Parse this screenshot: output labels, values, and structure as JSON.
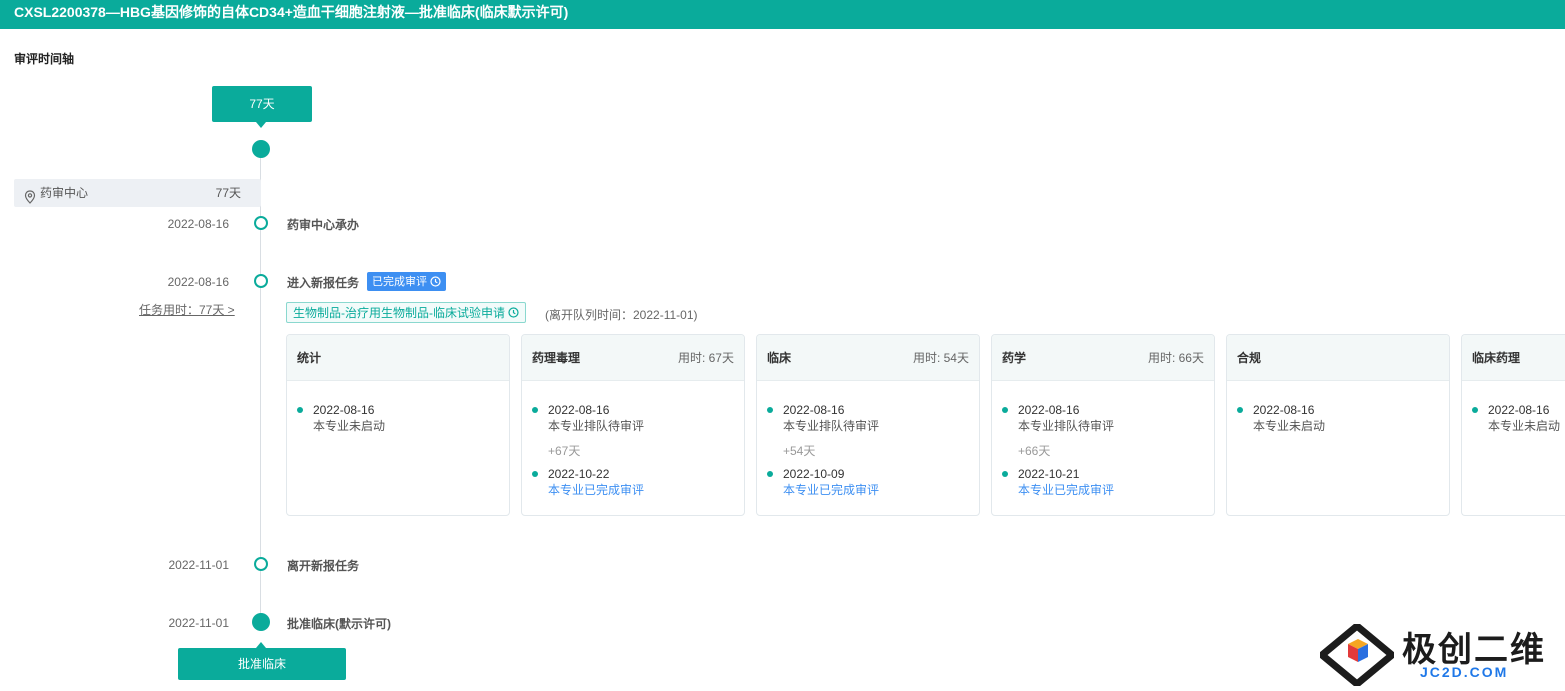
{
  "header": {
    "title": "CXSL2200378—HBG基因修饰的自体CD34+造血干细胞注射液—批准临床(临床默示许可)"
  },
  "timeline": {
    "section_title": "审评时间轴",
    "total_badge": "77天",
    "center": {
      "name": "药审中心",
      "days": "77天"
    },
    "events": [
      {
        "date": "2022-08-16",
        "label": "药审中心承办"
      },
      {
        "date": "2022-08-16",
        "label": "进入新报任务",
        "status": "已完成审评",
        "task_link": "任务用时：77天 >"
      },
      {
        "date": "2022-11-01",
        "label": "离开新报任务"
      },
      {
        "date": "2022-11-01",
        "label": "批准临床(默示许可)"
      }
    ],
    "task_type_tag": "生物制品-治疗用生物制品-临床试验申请",
    "leave_queue_time": "(离开队列时间：2022-11-01)",
    "final_badge": "批准临床"
  },
  "cards": [
    {
      "name": "统计",
      "used": "",
      "entries": [
        {
          "date": "2022-08-16",
          "status": "本专业未启动",
          "done": false
        }
      ],
      "gap": ""
    },
    {
      "name": "药理毒理",
      "used": "用时: 67天",
      "entries": [
        {
          "date": "2022-08-16",
          "status": "本专业排队待审评",
          "done": false
        },
        {
          "date": "2022-10-22",
          "status": "本专业已完成审评",
          "done": true
        }
      ],
      "gap": "+67天"
    },
    {
      "name": "临床",
      "used": "用时: 54天",
      "entries": [
        {
          "date": "2022-08-16",
          "status": "本专业排队待审评",
          "done": false
        },
        {
          "date": "2022-10-09",
          "status": "本专业已完成审评",
          "done": true
        }
      ],
      "gap": "+54天"
    },
    {
      "name": "药学",
      "used": "用时: 66天",
      "entries": [
        {
          "date": "2022-08-16",
          "status": "本专业排队待审评",
          "done": false
        },
        {
          "date": "2022-10-21",
          "status": "本专业已完成审评",
          "done": true
        }
      ],
      "gap": "+66天"
    },
    {
      "name": "合规",
      "used": "",
      "entries": [
        {
          "date": "2022-08-16",
          "status": "本专业未启动",
          "done": false
        }
      ],
      "gap": ""
    },
    {
      "name": "临床药理",
      "used": "",
      "entries": [
        {
          "date": "2022-08-16",
          "status": "本专业未启动",
          "done": false
        }
      ],
      "gap": ""
    }
  ],
  "watermark": {
    "text": "极创二维",
    "sub": "JC2D.COM"
  }
}
